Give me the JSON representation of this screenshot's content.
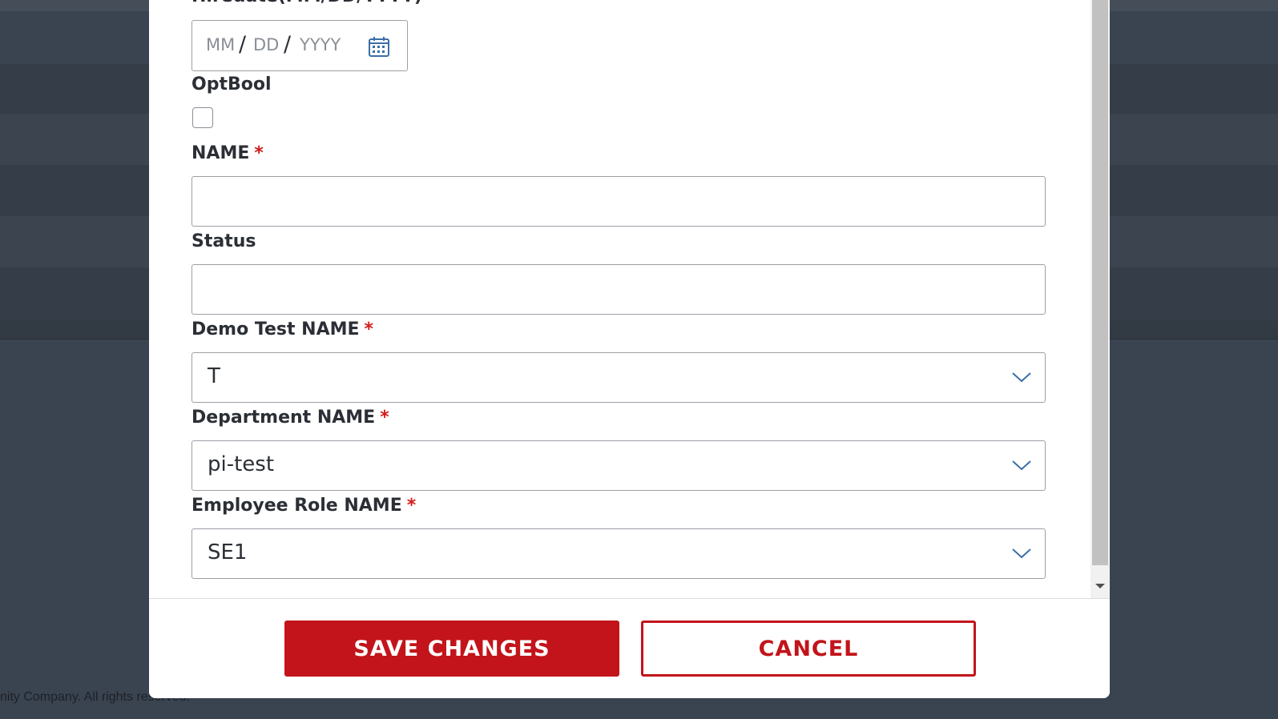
{
  "background": {
    "footer_text": "nity Company. All rights reserved."
  },
  "form": {
    "hiredate_label": "Hiredate(MM/DD/YYYY)",
    "hiredate": {
      "month_placeholder": "MM",
      "day_placeholder": "DD",
      "year_placeholder": "YYYY",
      "separator": "/"
    },
    "optbool_label": "OptBool",
    "optbool_checked": false,
    "name_label": "NAME",
    "name_value": "",
    "status_label": "Status",
    "status_value": "",
    "demo_test_label": "Demo Test NAME",
    "demo_test_value": "T",
    "department_label": "Department NAME",
    "department_value": "pi-test",
    "employee_role_label": "Employee Role NAME",
    "employee_role_value": "SE1",
    "required_mark": "*"
  },
  "footer": {
    "save_label": "SAVE CHANGES",
    "cancel_label": "CANCEL"
  },
  "colors": {
    "accent": "#c2141a",
    "required": "#d41b1b",
    "overlay": "#3a4350",
    "icon": "#3b6ea8"
  }
}
